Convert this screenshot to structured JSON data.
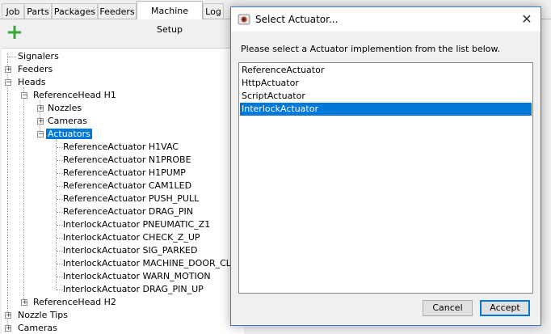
{
  "tabs": [
    "Job",
    "Parts",
    "Packages",
    "Feeders",
    "Machine Setup",
    "Log"
  ],
  "active_tab": "Machine Setup",
  "toolbar": {
    "add_icon": "plus-icon"
  },
  "tree": {
    "signalers": "Signalers",
    "feeders": "Feeders",
    "heads": "Heads",
    "head1": "ReferenceHead H1",
    "nozzles": "Nozzles",
    "cameras_sub": "Cameras",
    "actuators": "Actuators",
    "actuator_items": [
      "ReferenceActuator H1VAC",
      "ReferenceActuator N1PROBE",
      "ReferenceActuator H1PUMP",
      "ReferenceActuator CAM1LED",
      "ReferenceActuator PUSH_PULL",
      "ReferenceActuator DRAG_PIN",
      "InterlockActuator PNEUMATIC_Z1",
      "InterlockActuator CHECK_Z_UP",
      "InterlockActuator SIG_PARKED",
      "InterlockActuator MACHINE_DOOR_CLOSE",
      "InterlockActuator WARN_MOTION",
      "InterlockActuator DRAG_PIN_UP"
    ],
    "head2": "ReferenceHead H2",
    "nozzle_tips": "Nozzle Tips",
    "cameras": "Cameras"
  },
  "dialog": {
    "title": "Select Actuator...",
    "prompt": "Please select a Actuator implemention from the list below.",
    "options": [
      "ReferenceActuator",
      "HttpActuator",
      "ScriptActuator",
      "InterlockActuator"
    ],
    "selected": "InterlockActuator",
    "cancel_label": "Cancel",
    "accept_label": "Accept"
  },
  "colors": {
    "selection": "#0078d7",
    "add_icon": "#3aa63a"
  }
}
